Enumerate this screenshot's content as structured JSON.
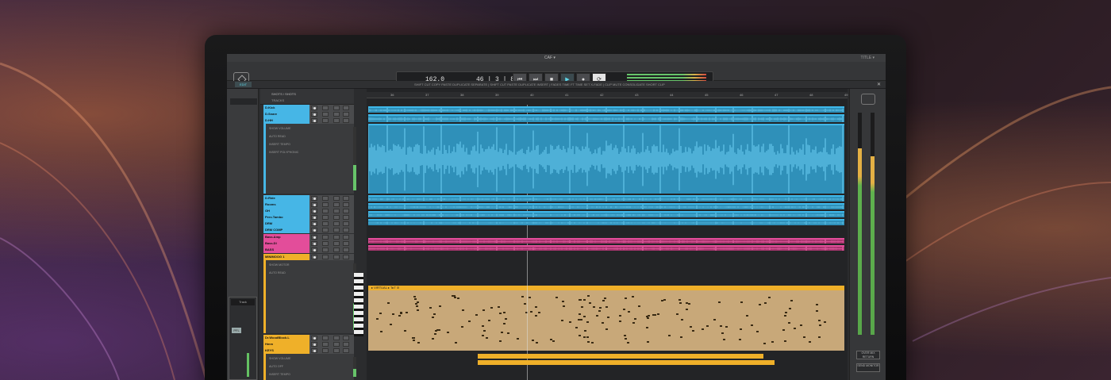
{
  "window": {
    "title": "CAF ▾",
    "right_info": "TITLE ▾"
  },
  "transport": {
    "tempo": "162.0",
    "position": "46 | 3 | 834",
    "buttons": [
      "⏮",
      "⏭",
      "■",
      "▶",
      "●",
      "⟳"
    ]
  },
  "mode": {
    "edit": "EDIT",
    "tools": "SHIFT  CUT  COPY  PASTE  DUPLICATE  SEPARATE  |  SHIFT  CUT  PASTE  DUPLICATE  INSERT  |  FADES  TIME FT  TIME SET  X-FADE  |  CLIP  MUTE  CONSOLIDATE  SHORT CLIP",
    "close": "✕"
  },
  "tracklist": {
    "header": "SHOTS / SHOTS",
    "tracks_label": "TRACKS",
    "tracks": [
      {
        "name": "D.Kick",
        "color": "blue"
      },
      {
        "name": "D.Snare",
        "color": "blue"
      },
      {
        "name": "D.HH",
        "color": "blue"
      },
      {
        "name": "D.Ride",
        "color": "blue"
      },
      {
        "name": "Rooms",
        "color": "blue"
      },
      {
        "name": "OH",
        "color": "blue"
      },
      {
        "name": "Perc.Tambo",
        "color": "blue"
      },
      {
        "name": "DRM",
        "color": "blue"
      },
      {
        "name": "DRM COMP",
        "color": "blue"
      },
      {
        "name": "Bass.Amp",
        "color": "pink"
      },
      {
        "name": "Bass.DI",
        "color": "pink"
      },
      {
        "name": "BASS",
        "color": "pink"
      },
      {
        "name": "MINIMOOG 1",
        "color": "orange"
      },
      {
        "name": "Dr.WoodBlock.L",
        "color": "orange"
      },
      {
        "name": "Hmm",
        "color": "orange"
      },
      {
        "name": "KEYS",
        "color": "orange"
      }
    ],
    "drum_params": [
      "SHOW   VOLUME",
      "AUTO   READ",
      "INSERT   TEMPO",
      "INSERT   POLYPHONIC"
    ],
    "moog_params": [
      "SHOW   MOTOR",
      "AUTO   READ"
    ],
    "keys_params": [
      "SHOW   VOLUME",
      "AUTO   OFF",
      "INSERT   TEMPO"
    ]
  },
  "ruler": [
    "36",
    "37",
    "38",
    "39",
    "40",
    "41",
    "42",
    "43",
    "44",
    "45",
    "46",
    "47",
    "48",
    "49"
  ],
  "midi": {
    "label": "▸ VIRTUAL ▸  T▸T  ⊘"
  },
  "left_strip": {
    "fader_label": "Track",
    "button": "PFL"
  },
  "right_panel": {
    "buttons": [
      "OVER MIX RETURN",
      "SEND MONITOR"
    ]
  },
  "colors": {
    "blue": "#46b6e6",
    "pink": "#e34d9a",
    "orange": "#efb029",
    "accent": "#5fd6e8"
  }
}
